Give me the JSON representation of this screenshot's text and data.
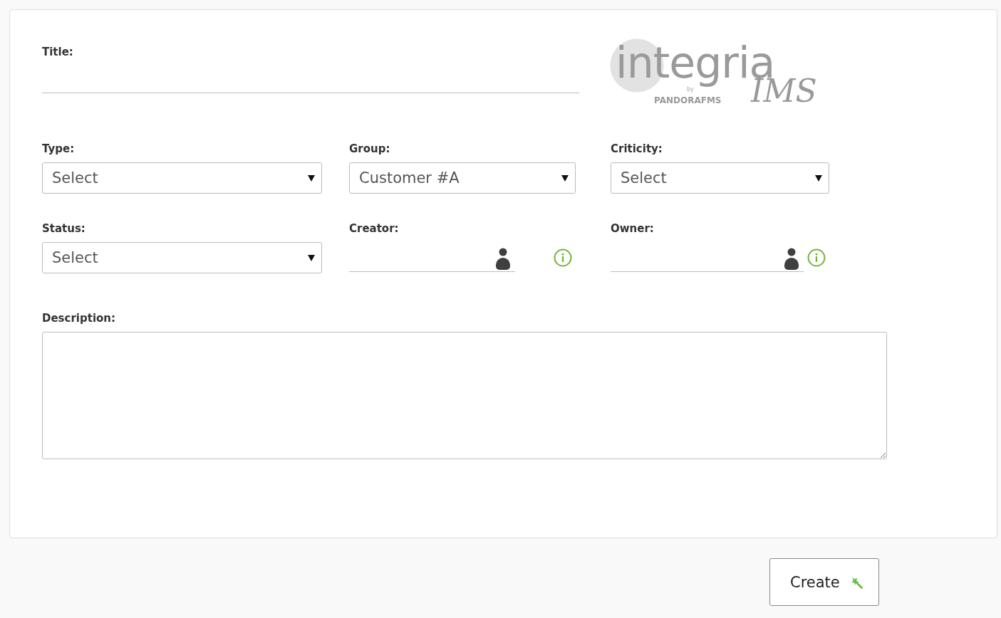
{
  "form": {
    "title_field": {
      "label": "Title:"
    },
    "logo": {
      "name": "integria",
      "suffix": "IMS",
      "by": "by",
      "vendor": "PANDORAFMS"
    },
    "rows": [
      [
        {
          "kind": "select",
          "label": "Type:",
          "value": "Select"
        },
        {
          "kind": "select",
          "label": "Group:",
          "value": "Customer #A"
        },
        {
          "kind": "select",
          "label": "Criticity:",
          "value": "Select"
        }
      ],
      [
        {
          "kind": "select",
          "label": "Status:",
          "value": "Select"
        },
        {
          "kind": "user",
          "label": "Creator:"
        },
        {
          "kind": "user",
          "label": "Owner:"
        }
      ]
    ],
    "description": {
      "label": "Description:"
    }
  },
  "buttons": [
    {
      "label": "Create"
    }
  ]
}
